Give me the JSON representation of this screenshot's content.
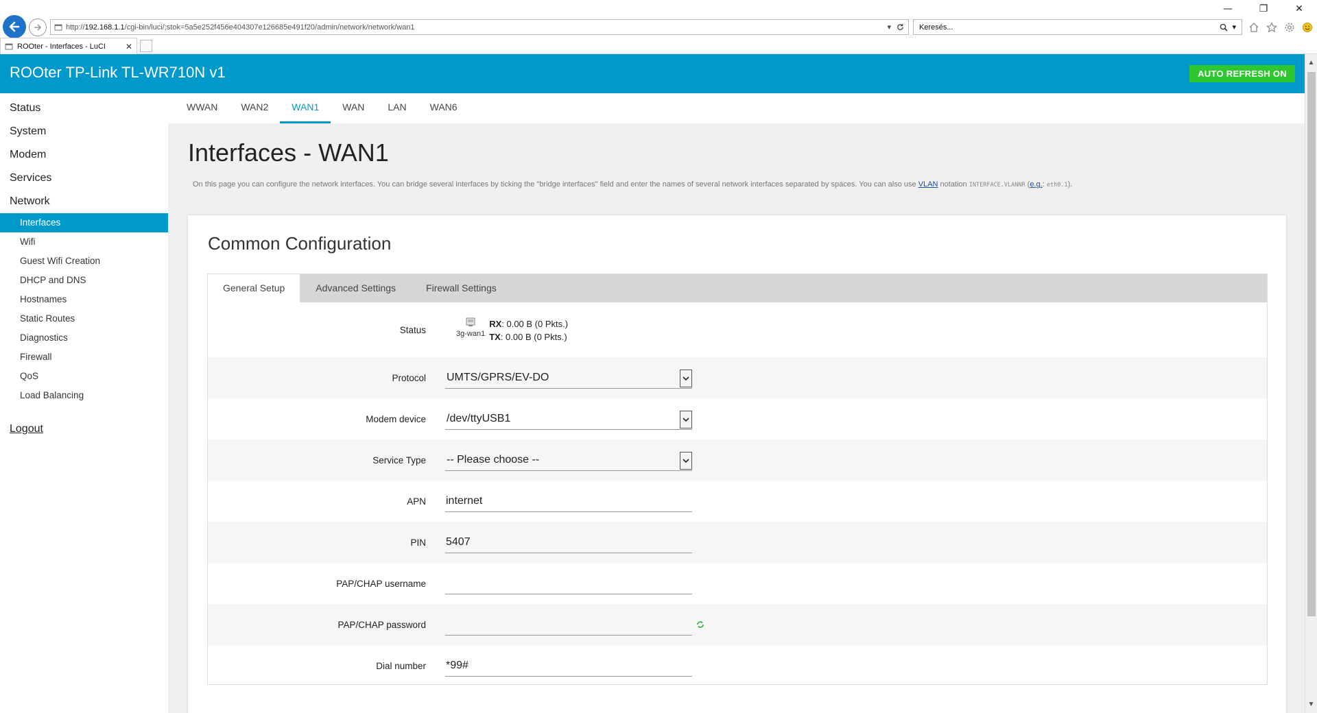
{
  "browser": {
    "url_prefix": "http://",
    "url_host": "192.168.1.1",
    "url_path": "/cgi-bin/luci/;stok=5a5e252f456e404307e126685e491f20/admin/network/network/wan1",
    "search_value": "Keresés...",
    "tab_title": "ROOter - Interfaces - LuCI"
  },
  "header": {
    "brand": "ROOter TP-Link TL-WR710N v1",
    "auto_refresh": "AUTO REFRESH ON"
  },
  "sidebar": {
    "top": [
      "Status",
      "System",
      "Modem",
      "Services",
      "Network"
    ],
    "sub": [
      "Interfaces",
      "Wifi",
      "Guest Wifi Creation",
      "DHCP and DNS",
      "Hostnames",
      "Static Routes",
      "Diagnostics",
      "Firewall",
      "QoS",
      "Load Balancing"
    ],
    "logout": "Logout"
  },
  "subtabs": [
    "WWAN",
    "WAN2",
    "WAN1",
    "WAN",
    "LAN",
    "WAN6"
  ],
  "page": {
    "title": "Interfaces - WAN1",
    "desc_before": "On this page you can configure the network interfaces. You can bridge several interfaces by ticking the \"bridge interfaces\" field and enter the names of several network interfaces separated by spaces. You can also use ",
    "desc_vlan": "VLAN",
    "desc_notation": " notation ",
    "desc_code1": "INTERFACE.VLANNR",
    "desc_open": " (",
    "desc_eg": "e.g.",
    "desc_colon": ": ",
    "desc_code2": "eth0.1",
    "desc_close": ")."
  },
  "card": {
    "title": "Common Configuration",
    "tabs": [
      "General Setup",
      "Advanced Settings",
      "Firewall Settings"
    ]
  },
  "form": {
    "status_label": "Status",
    "status_device": "3g-wan1",
    "rx_label": "RX",
    "rx_value": ": 0.00 B (0 Pkts.)",
    "tx_label": "TX",
    "tx_value": ": 0.00 B (0 Pkts.)",
    "protocol_label": "Protocol",
    "protocol_value": "UMTS/GPRS/EV-DO",
    "modem_label": "Modem device",
    "modem_value": "/dev/ttyUSB1",
    "service_label": "Service Type",
    "service_value": "-- Please choose --",
    "apn_label": "APN",
    "apn_value": "internet",
    "pin_label": "PIN",
    "pin_value": "5407",
    "username_label": "PAP/CHAP username",
    "username_value": "",
    "password_label": "PAP/CHAP password",
    "password_value": "",
    "dial_label": "Dial number",
    "dial_value": "*99#"
  },
  "colors": {
    "header_bg": "#0099cc",
    "active_item": "#0099cc",
    "refresh_btn": "#2fc72f"
  },
  "icons": [
    "back-arrow-icon",
    "forward-arrow-icon",
    "page-icon",
    "refresh-icon",
    "search-icon",
    "home-icon",
    "star-icon",
    "gear-icon",
    "smiley-icon",
    "network-device-icon",
    "reveal-password-icon"
  ]
}
